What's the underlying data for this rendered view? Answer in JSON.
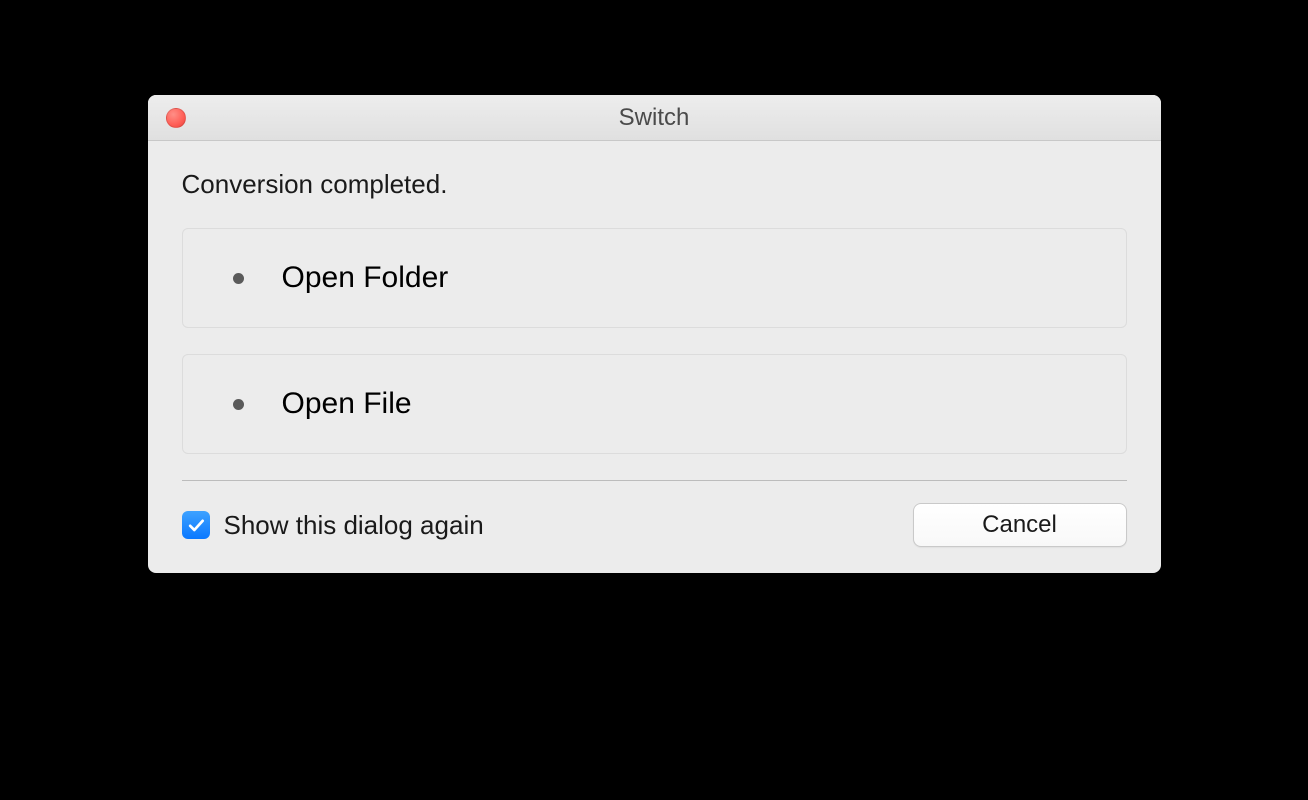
{
  "dialog": {
    "title": "Switch",
    "message": "Conversion completed.",
    "options": [
      {
        "label": "Open Folder"
      },
      {
        "label": "Open File"
      }
    ],
    "checkbox": {
      "label": "Show this dialog again",
      "checked": true
    },
    "cancel_label": "Cancel"
  }
}
